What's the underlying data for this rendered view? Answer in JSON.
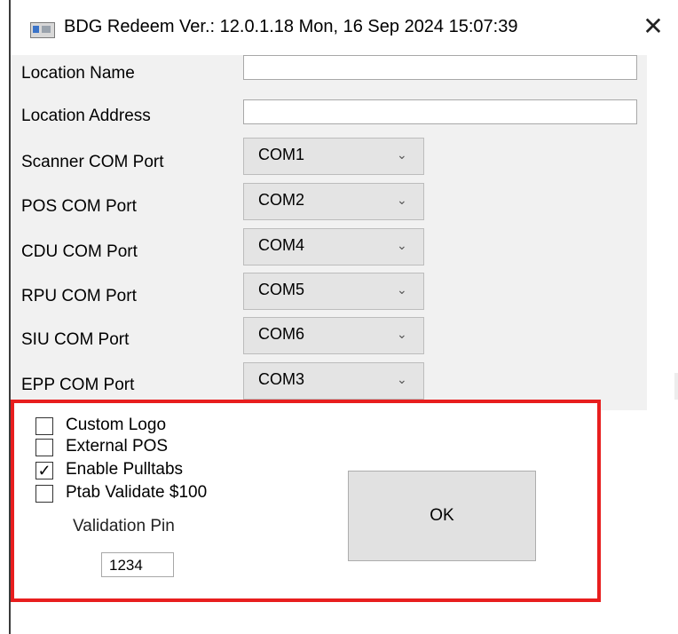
{
  "window": {
    "title": "BDG Redeem Ver.: 12.0.1.18 Mon, 16 Sep 2024 15:07:39",
    "close_symbol": "✕"
  },
  "location": {
    "name_label": "Location Name",
    "name_value": "",
    "address_label": "Location Address",
    "address_value": ""
  },
  "ports": [
    {
      "label": "Scanner COM Port",
      "value": "COM1"
    },
    {
      "label": "POS COM Port",
      "value": "COM2"
    },
    {
      "label": "CDU COM Port",
      "value": "COM4"
    },
    {
      "label": "RPU COM Port",
      "value": "COM5"
    },
    {
      "label": "SIU COM Port",
      "value": "COM6"
    },
    {
      "label": "EPP COM Port",
      "value": "COM3"
    }
  ],
  "combo_arrow": "⌄",
  "options": {
    "custom_logo": {
      "label": "Custom Logo",
      "checked": false
    },
    "external_pos": {
      "label": "External POS",
      "checked": false
    },
    "enable_pulltabs": {
      "label": "Enable Pulltabs",
      "checked": true,
      "mark": "✓"
    },
    "ptab_validate": {
      "label": "Ptab Validate $100",
      "checked": false
    }
  },
  "validation": {
    "pin_label": "Validation Pin",
    "pin_value": "1234"
  },
  "ok_label": "OK",
  "colors": {
    "highlight_border": "#e81e1e",
    "combo_bg": "#e4e4e4",
    "button_bg": "#e1e1e1"
  }
}
